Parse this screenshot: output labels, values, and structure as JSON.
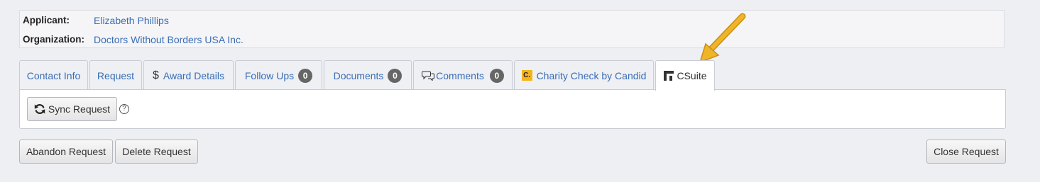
{
  "applicant": {
    "label": "Applicant:",
    "value": "Elizabeth Phillips"
  },
  "organization": {
    "label": "Organization:",
    "value": "Doctors Without Borders USA Inc."
  },
  "tabs": [
    {
      "label": "Contact Info"
    },
    {
      "label": "Request"
    },
    {
      "label": "Award Details",
      "icon": "dollar-icon",
      "icon_glyph": "$"
    },
    {
      "label": "Follow Ups",
      "badge": "0"
    },
    {
      "label": "Documents",
      "badge": "0"
    },
    {
      "label": "Comments",
      "badge": "0",
      "icon": "comments-icon"
    },
    {
      "label": "Charity Check by Candid",
      "icon": "candid-icon",
      "icon_glyph": "C."
    },
    {
      "label": "CSuite",
      "icon": "csuite-icon",
      "active": true
    }
  ],
  "panel": {
    "sync_label": "Sync Request",
    "sync_icon": "sync-icon",
    "help_glyph": "?"
  },
  "footer": {
    "abandon_label": "Abandon Request",
    "delete_label": "Delete Request",
    "close_label": "Close Request"
  },
  "colors": {
    "link": "#3a6db5",
    "badge": "#666666",
    "candid": "#f2b41f",
    "arrow": "#f0b429"
  }
}
